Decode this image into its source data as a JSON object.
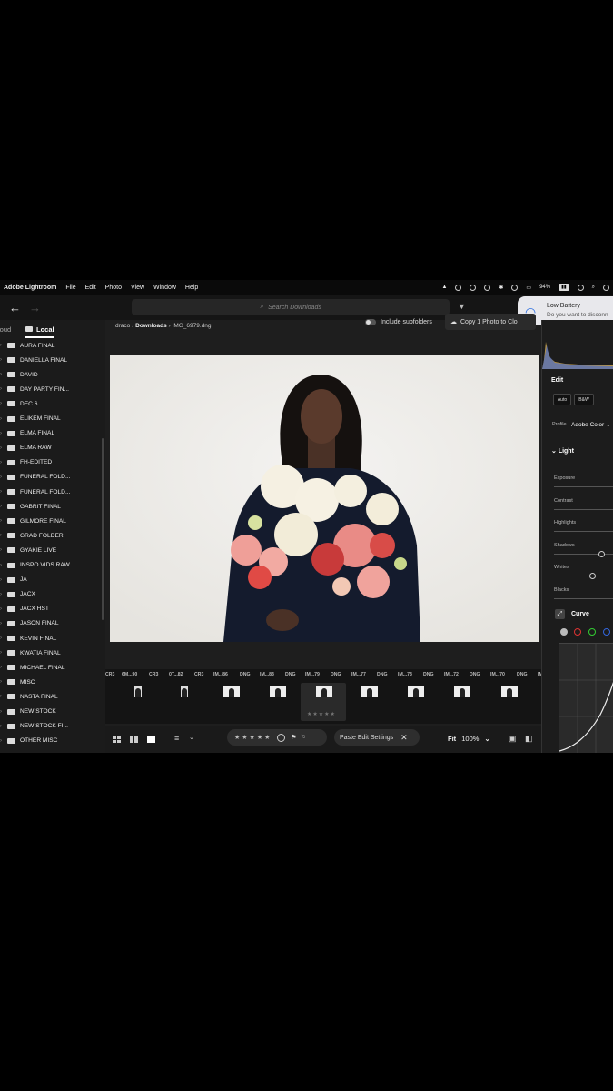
{
  "menubar": {
    "app": "Adobe Lightroom",
    "items": [
      "File",
      "Edit",
      "Photo",
      "View",
      "Window",
      "Help"
    ],
    "battery_percent": "94%"
  },
  "toolbar": {
    "search_placeholder": "Search Downloads"
  },
  "notification": {
    "title": "Low Battery",
    "body": "Do you want to disconn"
  },
  "sidebar": {
    "tab_cloud": "loud",
    "tab_local": "Local",
    "folders": [
      "AURA FINAL",
      "DANIELLA FINAL",
      "DAVID",
      "DAY PARTY FIN...",
      "DEC 6",
      "ELIKEM FINAL",
      "ELMA FINAL",
      "ELMA RAW",
      "FH-EDITED",
      "FUNERAL FOLD...",
      "FUNERAL FOLD...",
      "GABRIT FINAL",
      "GILMORE FINAL",
      "GRAD FOLDER",
      "GYAKIE LIVE",
      "INSPO VIDS RAW",
      "JA",
      "JACX",
      "JACX HST",
      "JASON FINAL",
      "KEVIN FINAL",
      "KWATIA FINAL",
      "MICHAEL FINAL",
      "MISC",
      "NASTA FINAL",
      "NEW STOCK",
      "NEW STOCK FI...",
      "OTHER MISC"
    ]
  },
  "breadcrumb": {
    "root": "draco",
    "folder": "Downloads",
    "file": "IMG_6979.dng"
  },
  "include_subfolders": "Include subfolders",
  "copy_button": "Copy 1 Photo to Clo",
  "filmstrip": {
    "labels": [
      "CR3",
      "6M...90",
      "CR3",
      "0T...82",
      "CR3",
      "IM...86",
      "DNG",
      "IM...83",
      "DNG",
      "IM...79",
      "DNG",
      "IM...77",
      "DNG",
      "IM...73",
      "DNG",
      "IM...72",
      "DNG",
      "IM...70",
      "DNG",
      "IM..."
    ],
    "selected_index": 4,
    "selected_rating": "★★★★★"
  },
  "bottombar": {
    "rating_stars": "★★★★★",
    "paste_label": "Paste Edit Settings",
    "fit_label": "Fit",
    "zoom": "100%"
  },
  "rightpanel": {
    "edit_title": "Edit",
    "auto_label": "Auto",
    "bw_label": "B&W",
    "profile_label": "Profile",
    "profile_value": "Adobe Color",
    "light_title": "Light",
    "sliders": [
      "Exposure",
      "Contrast",
      "Highlights",
      "Shadows",
      "Whites",
      "Blacks"
    ],
    "curve_title": "Curve"
  },
  "colors": {
    "accent_blue": "#2a6de0",
    "panel_bg": "#1c1c1c"
  }
}
